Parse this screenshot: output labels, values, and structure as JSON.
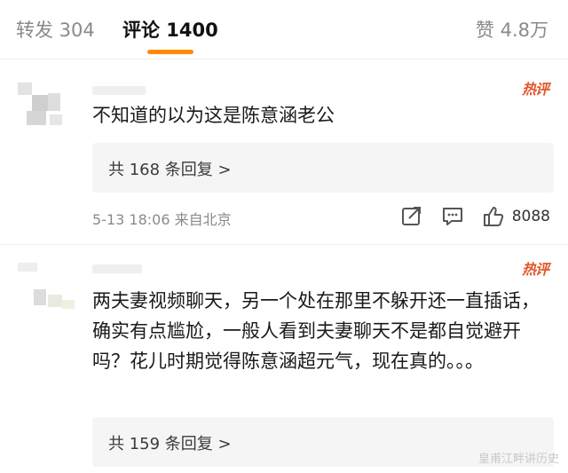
{
  "tabs": {
    "repost": "转发 304",
    "comment": "评论 1400",
    "like": "赞 4.8万"
  },
  "comments": [
    {
      "hot_label": "热评",
      "text": "不知道的以为这是陈意涵老公",
      "replies": "共 168 条回复 >",
      "meta": "5-13 18:06 来自北京",
      "likes": "8088"
    },
    {
      "hot_label": "热评",
      "text": "两夫妻视频聊天，另一个处在那里不躲开还一直插话，确实有点尴尬，一般人看到夫妻聊天不是都自觉避开吗？花儿时期觉得陈意涵超元气，现在真的。。。",
      "replies": "共 159 条回复 >"
    }
  ],
  "watermark": "皇甫江畔讲历史",
  "colors": {
    "accent": "#ff8a00",
    "hot": "#e2562a",
    "reply_bg": "#f5f5f5"
  },
  "icons": [
    "share-icon",
    "comment-icon",
    "thumbs-up-icon"
  ]
}
